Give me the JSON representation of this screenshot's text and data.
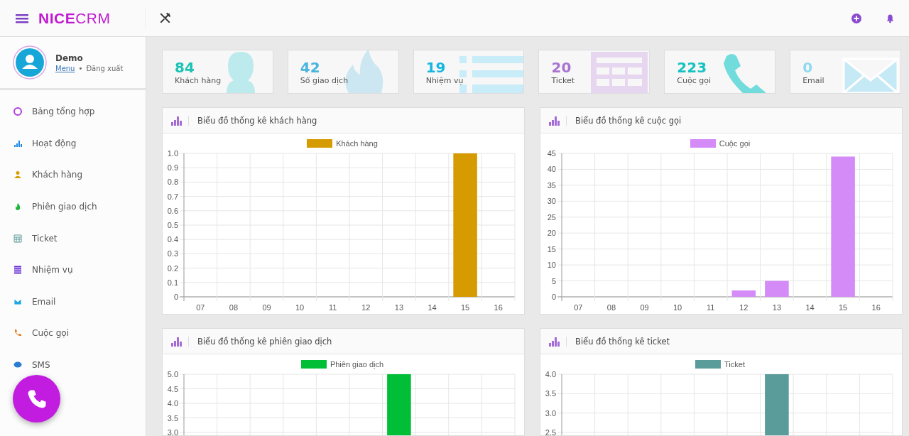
{
  "topbar": {
    "logo": {
      "bold": "NICE",
      "light": "CRM"
    }
  },
  "profile": {
    "name": "Demo",
    "menu_link": "Menu",
    "separator": "•",
    "logout_link": "Đăng xuất"
  },
  "sidebar": {
    "items": [
      {
        "label": "Bảng tổng hợp"
      },
      {
        "label": "Hoạt động"
      },
      {
        "label": "Khách hàng"
      },
      {
        "label": "Phiên giao dịch"
      },
      {
        "label": "Ticket"
      },
      {
        "label": "Nhiệm vụ"
      },
      {
        "label": "Email"
      },
      {
        "label": "Cuộc gọi"
      },
      {
        "label": "SMS"
      }
    ]
  },
  "stats": [
    {
      "value": "84",
      "label": "Khách hàng",
      "color": "#1bc3b5"
    },
    {
      "value": "42",
      "label": "Số giao dịch",
      "color": "#4ab4de"
    },
    {
      "value": "19",
      "label": "Nhiệm vụ",
      "color": "#16b6e0"
    },
    {
      "value": "20",
      "label": "Ticket",
      "color": "#a974d0"
    },
    {
      "value": "223",
      "label": "Cuộc gọi",
      "color": "#17c3c2"
    },
    {
      "value": "0",
      "label": "Email",
      "color": "#8fdaf0"
    }
  ],
  "panels": [
    {
      "title": "Biểu đồ thống kê khách hàng",
      "chart_data": {
        "type": "bar",
        "grid": true,
        "categories": [
          "07",
          "08",
          "09",
          "10",
          "11",
          "12",
          "13",
          "14",
          "15",
          "16"
        ],
        "series": [
          {
            "name": "Khách hàng",
            "color": "#d59b00",
            "values": [
              0,
              0,
              0,
              0,
              0,
              0,
              0,
              0,
              1,
              0
            ]
          }
        ],
        "ylim": [
          0,
          1
        ],
        "yticks": [
          0,
          {
            "value": 0.1,
            "label": "0.1"
          },
          {
            "value": 0.2,
            "label": "0.2"
          },
          {
            "value": 0.3,
            "label": "0.3"
          },
          {
            "value": 0.4,
            "label": "0.4"
          },
          {
            "value": 0.5,
            "label": "0.5"
          },
          {
            "value": 0.6,
            "label": "0.6"
          },
          {
            "value": 0.7,
            "label": "0.7"
          },
          {
            "value": 0.8,
            "label": "0.8"
          },
          {
            "value": 0.9,
            "label": "0.9"
          },
          {
            "value": 1,
            "label": "1.0"
          }
        ]
      }
    },
    {
      "title": "Biểu đồ thống kê cuộc gọi",
      "chart_data": {
        "type": "bar",
        "grid": true,
        "categories": [
          "07",
          "08",
          "09",
          "10",
          "11",
          "12",
          "13",
          "14",
          "15",
          "16"
        ],
        "series": [
          {
            "name": "Cuộc gọi",
            "color": "#d58bf7",
            "values": [
              0,
              0,
              0,
              0,
              0,
              2,
              5,
              0,
              44,
              0
            ]
          }
        ],
        "ylim": [
          0,
          45
        ],
        "yticks": [
          0,
          5,
          10,
          15,
          20,
          25,
          30,
          35,
          40,
          45
        ]
      }
    },
    {
      "title": "Biểu đồ thống kê phiên giao dịch",
      "chart_data": {
        "type": "bar",
        "grid": true,
        "series": [
          {
            "name": "Phiên giao dịch",
            "color": "#00bf37",
            "values": [
              null,
              null,
              null,
              null,
              null,
              null,
              5,
              null,
              null,
              null
            ]
          }
        ],
        "ylim": [
          3,
          5
        ],
        "yticks": [
          {
            "value": 3,
            "label": "3.0"
          },
          {
            "value": 3.5,
            "label": "3.5"
          },
          {
            "value": 4,
            "label": "4.0"
          },
          {
            "value": 4.5,
            "label": "4.5"
          },
          {
            "value": 5,
            "label": "5.0"
          }
        ]
      }
    },
    {
      "title": "Biểu đồ thống kê ticket",
      "chart_data": {
        "type": "bar",
        "grid": true,
        "series": [
          {
            "name": "Ticket",
            "color": "#5a9c9a",
            "values": [
              null,
              null,
              null,
              null,
              null,
              null,
              4,
              null,
              null,
              null
            ]
          }
        ],
        "ylim": [
          2.5,
          4
        ],
        "yticks": [
          {
            "value": 2.5,
            "label": "2.5"
          },
          {
            "value": 3,
            "label": "3.0"
          },
          {
            "value": 3.5,
            "label": "3.5"
          },
          {
            "value": 4,
            "label": "4.0"
          }
        ]
      }
    }
  ]
}
